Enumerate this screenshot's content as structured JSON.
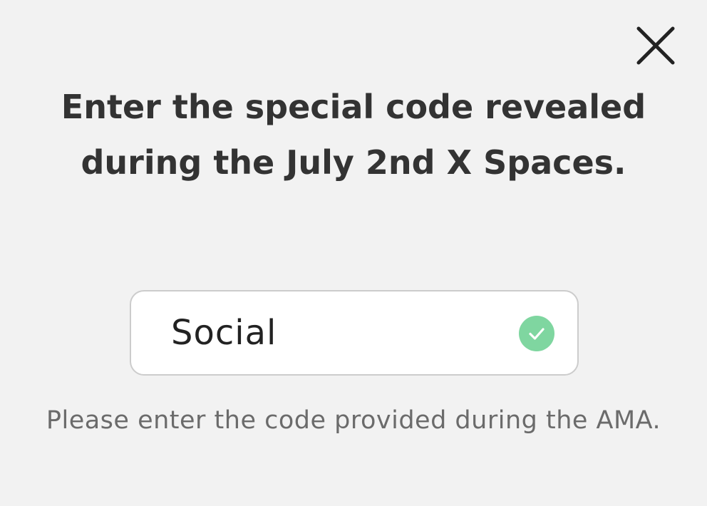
{
  "dialog": {
    "heading": "Enter the special code revealed during the July 2nd X Spaces.",
    "close_icon": "close-icon",
    "code_field": {
      "value": "Social",
      "placeholder": "",
      "status_icon": "check-circle-icon",
      "status": "valid"
    },
    "hint": "Please enter the code provided during the AMA."
  },
  "colors": {
    "background": "#f2f2f2",
    "heading": "#333333",
    "hint": "#6b6b6b",
    "field_border": "#cccccc",
    "success": "#7fd6a0"
  }
}
